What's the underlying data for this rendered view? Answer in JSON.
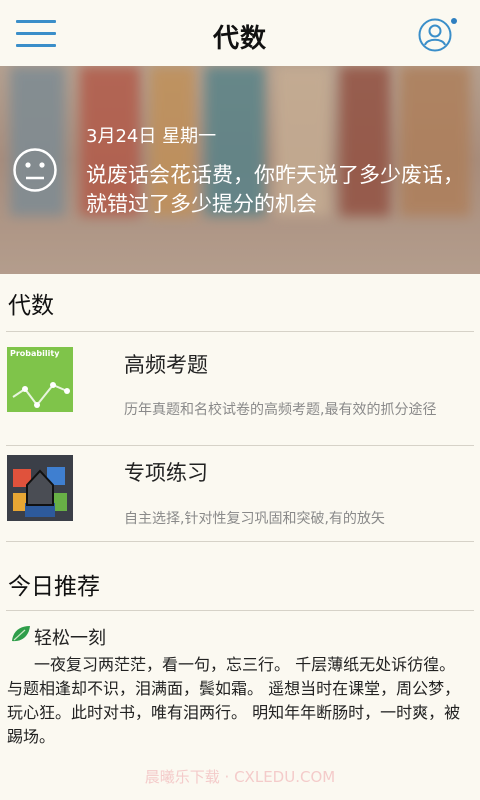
{
  "header": {
    "title": "代数"
  },
  "banner": {
    "date": "3月24日 星期一",
    "quote": "说废话会花话费，你昨天说了多少废话，就错过了多少提分的机会"
  },
  "section_title": "代数",
  "items": [
    {
      "thumb_label": "Probability",
      "title": "高频考题",
      "desc": "历年真题和名校试卷的高频考题,最有效的抓分途径"
    },
    {
      "title": "专项练习",
      "desc": "自主选择,针对性复习巩固和突破,有的放矢"
    }
  ],
  "recommend": {
    "title": "今日推荐",
    "label": "轻松一刻",
    "text": "一夜复习两茫茫，看一句，忘三行。 千层薄纸无处诉彷徨。与题相逢却不识，泪满面，鬓如霜。 遥想当时在课堂，周公梦，玩心狂。此时对书，唯有泪两行。 明知年年断肠时，一时爽，被踢场。"
  },
  "watermark": "晨曦乐下载 · CXLEDU.COM",
  "colors": {
    "accent": "#3a8ec9",
    "background": "#fbf9f1",
    "thumb_green": "#7fc44a",
    "leaf_green": "#2f9e4a"
  }
}
